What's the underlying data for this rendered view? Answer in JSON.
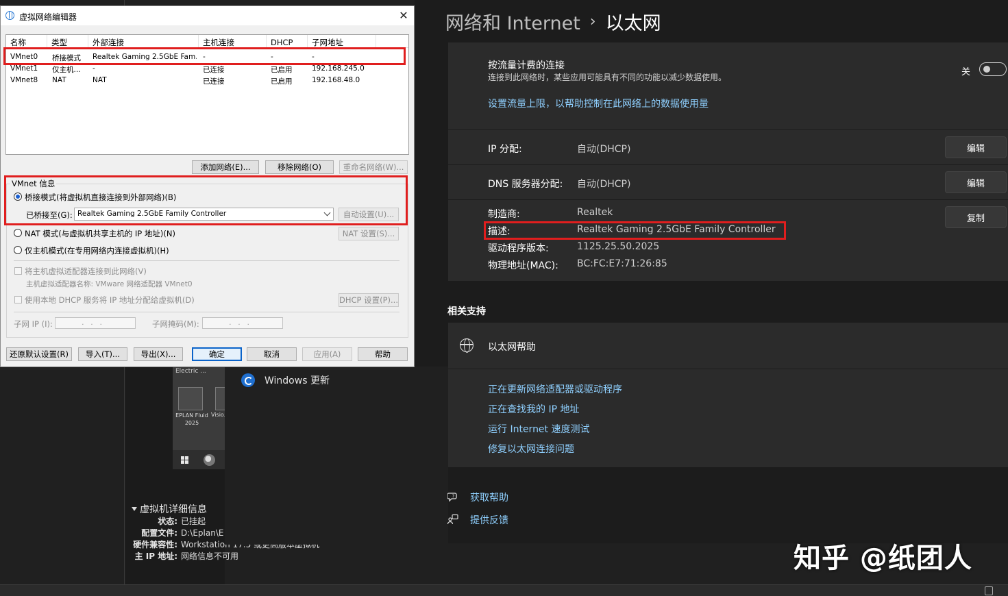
{
  "vmware": {
    "thumbnail": {
      "app1_label": "Electric ...",
      "app2_caption": "EPLAN Fluid 2025",
      "app3_caption": "Visio..."
    },
    "details": {
      "header": "虚拟机详细信息",
      "rows": [
        {
          "key": "状态:",
          "value": "已挂起"
        },
        {
          "key": "配置文件:",
          "value": "D:\\Eplan\\E"
        },
        {
          "key": "硬件兼容性:",
          "value": "Workstation 17.5 或更高版本虚拟机"
        },
        {
          "key": "主 IP 地址:",
          "value": "网络信息不可用"
        }
      ]
    },
    "windows_update_label": "Windows 更新"
  },
  "settings": {
    "breadcrumb_parent": "网络和 Internet",
    "breadcrumb_sep": "›",
    "breadcrumb_current": "以太网",
    "metered": {
      "title": "按流量计费的连接",
      "description": "连接到此网络时，某些应用可能具有不同的功能以减少数据使用。",
      "toggle_state": "关",
      "toggle_on": false,
      "data_limit_link": "设置流量上限，以帮助控制在此网络上的数据使用量"
    },
    "ip_assignment": {
      "label": "IP 分配:",
      "value": "自动(DHCP)",
      "button": "编辑"
    },
    "dns_assignment": {
      "label": "DNS 服务器分配:",
      "value": "自动(DHCP)",
      "button": "编辑"
    },
    "info": {
      "rows": [
        {
          "label": "制造商:",
          "value": "Realtek"
        },
        {
          "label": "描述:",
          "value": "Realtek Gaming 2.5GbE Family Controller"
        },
        {
          "label": "驱动程序版本:",
          "value": "1125.25.50.2025"
        },
        {
          "label": "物理地址(MAC):",
          "value": "BC:FC:E7:71:26:85"
        }
      ],
      "copy_button": "复制"
    },
    "related_support": {
      "heading": "相关支持",
      "ethernet_help": "以太网帮助",
      "links": [
        "正在更新网络适配器或驱动程序",
        "正在查找我的 IP 地址",
        "运行 Internet 速度测试",
        "修复以太网连接问题"
      ]
    },
    "get_help": "获取帮助",
    "give_feedback": "提供反馈",
    "accent_link_color": "#8fd0ff",
    "highlight_color": "#e01e1e"
  },
  "dialog": {
    "title": "虚拟网络编辑器",
    "close_glyph": "✕",
    "columns": [
      "名称",
      "类型",
      "外部连接",
      "主机连接",
      "DHCP",
      "子网地址"
    ],
    "networks": [
      {
        "name": "VMnet0",
        "type": "桥接模式",
        "external": "Realtek Gaming 2.5GbE Fam...",
        "host": "-",
        "dhcp": "-",
        "subnet": "-"
      },
      {
        "name": "VMnet1",
        "type": "仅主机...",
        "external": "-",
        "host": "已连接",
        "dhcp": "已启用",
        "subnet": "192.168.245.0"
      },
      {
        "name": "VMnet8",
        "type": "NAT",
        "external": "NAT",
        "host": "已连接",
        "dhcp": "已启用",
        "subnet": "192.168.48.0"
      }
    ],
    "add_network": "添加网络(E)...",
    "remove_network": "移除网络(O)",
    "rename_network": "重命名网络(W)...",
    "vmnet_info_title": "VMnet 信息",
    "bridged_option": "桥接模式(将虚拟机直接连接到外部网络)(B)",
    "bridged_to_label": "已桥接至(G):",
    "bridged_to_value": "Realtek Gaming 2.5GbE Family Controller",
    "auto_settings": "自动设置(U)...",
    "nat_option": "NAT 模式(与虚拟机共享主机的 IP 地址)(N)",
    "nat_settings": "NAT 设置(S)...",
    "host_only_option": "仅主机模式(在专用网络内连接虚拟机)(H)",
    "connect_host_adapter": "将主机虚拟适配器连接到此网络(V)",
    "host_adapter_name": "主机虚拟适配器名称: VMware 网络适配器 VMnet0",
    "use_dhcp": "使用本地 DHCP 服务将 IP 地址分配给虚拟机(D)",
    "dhcp_settings": "DHCP 设置(P)...",
    "subnet_ip_label": "子网 IP (I):",
    "subnet_mask_label": "子网掩码(M):",
    "ip_placeholder": "...",
    "restore_defaults": "还原默认设置(R)",
    "import": "导入(T)...",
    "export": "导出(X)...",
    "ok": "确定",
    "cancel": "取消",
    "apply": "应用(A)",
    "help": "帮助"
  },
  "watermark": "知乎 @纸团人"
}
